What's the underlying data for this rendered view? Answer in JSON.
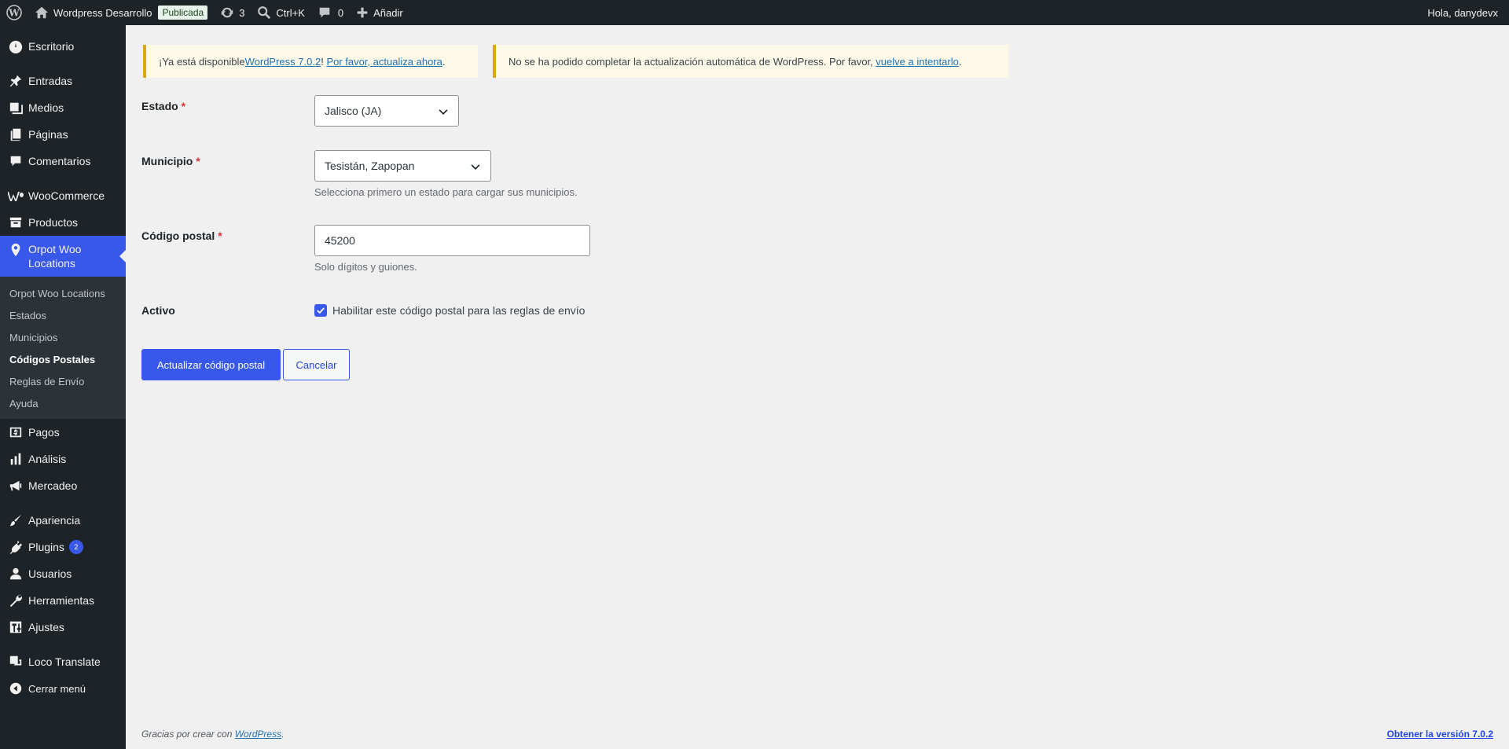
{
  "adminbar": {
    "site_name": "Wordpress Desarrollo",
    "status_badge": "Publicada",
    "updates_count": "3",
    "search_shortcut": "Ctrl+K",
    "comments_count": "0",
    "new_label": "Añadir",
    "greeting": "Hola, danydevx"
  },
  "sidebar": {
    "dashboard": "Escritorio",
    "posts": "Entradas",
    "media": "Medios",
    "pages": "Páginas",
    "comments": "Comentarios",
    "woocommerce": "WooCommerce",
    "products": "Productos",
    "locations": "Orpot Woo Locations",
    "submenu": [
      "Orpot Woo Locations",
      "Estados",
      "Municipios",
      "Códigos Postales",
      "Reglas de Envío",
      "Ayuda"
    ],
    "payments": "Pagos",
    "analytics": "Análisis",
    "marketing": "Mercadeo",
    "appearance": "Apariencia",
    "plugins": "Plugins",
    "plugins_badge": "2",
    "users": "Usuarios",
    "tools": "Herramientas",
    "settings": "Ajustes",
    "loco": "Loco Translate",
    "collapse": "Cerrar menú"
  },
  "notices": {
    "update_prefix": "¡Ya está disponible ",
    "update_link": "WordPress 7.0.2",
    "update_mid": "! ",
    "update_now_link": "Por favor, actualiza ahora",
    "update_end": ".",
    "auto_fail_text": "No se ha podido completar la actualización automática de WordPress. Por favor, ",
    "auto_fail_link": "vuelve a intentarlo",
    "auto_fail_end": "."
  },
  "form": {
    "estado_label": "Estado",
    "estado_value": "Jalisco (JA)",
    "municipio_label": "Municipio",
    "municipio_value": "Tesistán, Zapopan",
    "municipio_desc": "Selecciona primero un estado para cargar sus municipios.",
    "cp_label": "Código postal",
    "cp_value": "45200",
    "cp_desc": "Solo dígitos y guiones.",
    "activo_label": "Activo",
    "activo_checked": true,
    "activo_text": "Habilitar este código postal para las reglas de envío",
    "required_mark": "*",
    "submit": "Actualizar código postal",
    "cancel": "Cancelar"
  },
  "footer": {
    "thanks": "Gracias por crear con ",
    "wp_link": "WordPress",
    "thanks_end": ".",
    "version_link": "Obtener la versión 7.0.2"
  },
  "colors": {
    "accent": "#3858e9",
    "sidebar_bg": "#1d2327",
    "notice_border": "#dba617",
    "required": "#d63638"
  }
}
